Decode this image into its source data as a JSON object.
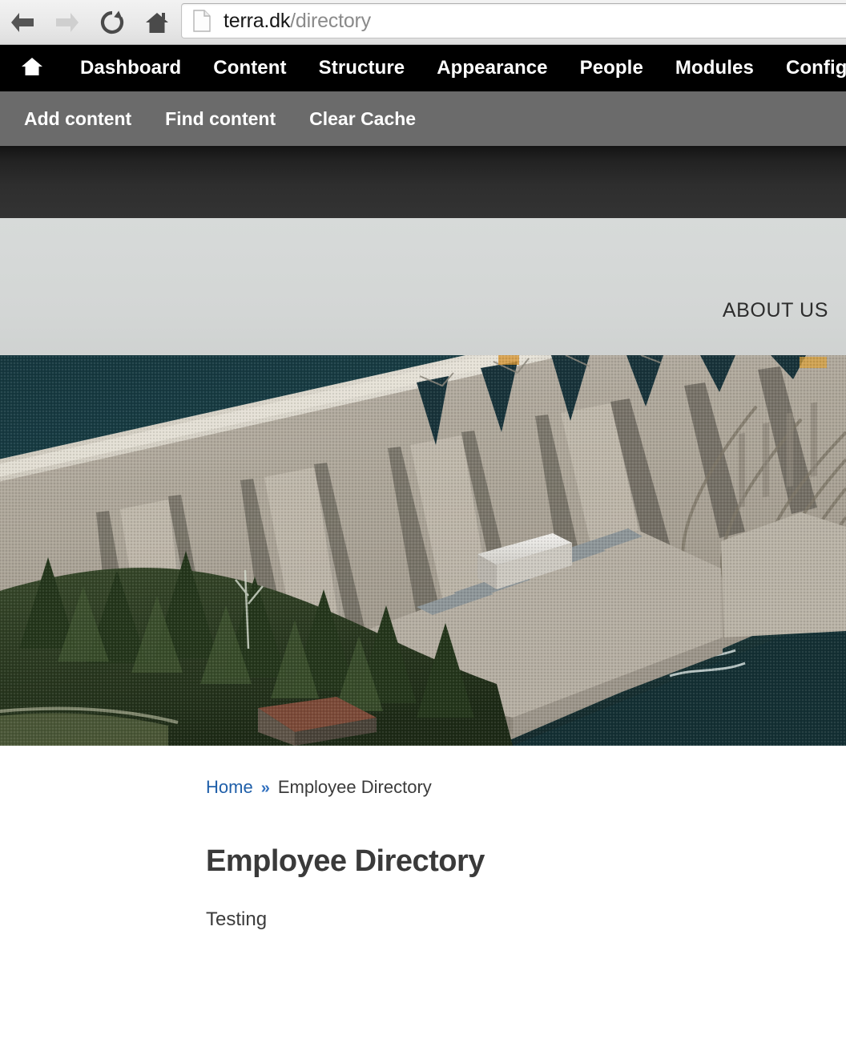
{
  "browser": {
    "back_icon": "arrow-left-icon",
    "forward_icon": "arrow-right-icon",
    "reload_icon": "reload-icon",
    "home_icon": "home-icon",
    "page_icon": "page-document-icon",
    "url_host": "terra.dk",
    "url_path": "/directory",
    "url_full": "terra.dk/directory"
  },
  "admin_toolbar": {
    "home_icon": "home-icon",
    "items": [
      {
        "label": "Dashboard"
      },
      {
        "label": "Content"
      },
      {
        "label": "Structure"
      },
      {
        "label": "Appearance"
      },
      {
        "label": "People"
      },
      {
        "label": "Modules"
      },
      {
        "label": "Configuration"
      }
    ]
  },
  "shortcut_bar": {
    "items": [
      {
        "label": "Add content"
      },
      {
        "label": "Find content"
      },
      {
        "label": "Clear Cache"
      }
    ]
  },
  "site_header": {
    "nav_label": "ABOUT US"
  },
  "hero": {
    "alt": "Aerial photograph of a concrete buttress dam with reservoir water, powerhouse buildings and forested hillside"
  },
  "content": {
    "breadcrumb": {
      "home_label": "Home",
      "separator": "»",
      "current_label": "Employee Directory"
    },
    "title": "Employee Directory",
    "body": "Testing"
  },
  "colors": {
    "admin_bar_bg": "#000000",
    "shortcut_bar_bg": "#6b6b6b",
    "dark_band_bg": "#2e2e2e",
    "site_header_bg": "#d4d7d6",
    "water_teal": "#193c44",
    "concrete": "#b4ada2",
    "link_blue": "#1f5fa9",
    "heading_gray": "#3a3a3a",
    "chrome_bg": "#e8e8e8"
  }
}
